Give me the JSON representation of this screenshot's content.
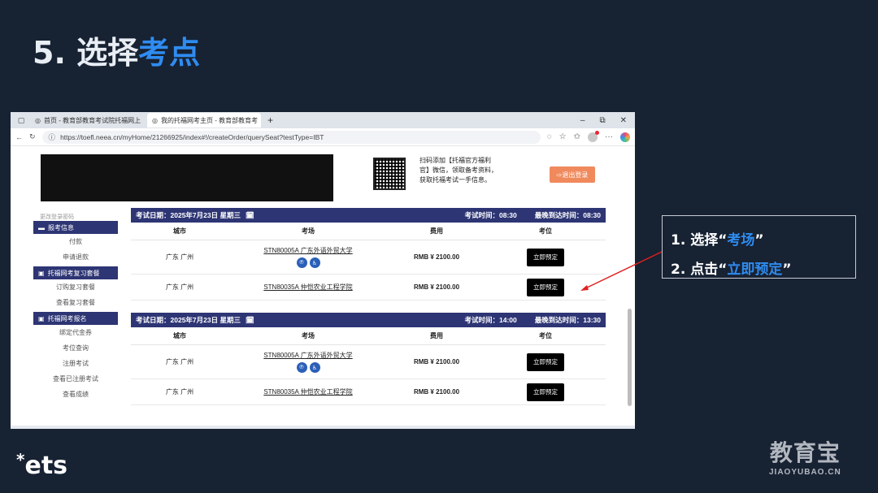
{
  "slide": {
    "title_prefix": "5. 选择",
    "title_accent": "考点"
  },
  "browser": {
    "tabs": [
      {
        "label": "首页 - 教育部教育考试院托福网上",
        "active": false
      },
      {
        "label": "我的托福网考主页 - 教育部教育考",
        "active": true
      }
    ],
    "window_controls": [
      "–",
      "⧉",
      "✕"
    ],
    "url": "https://toefl.neea.cn/myHome/21266925/index#!/createOrder/querySeat?testType=IBT"
  },
  "page": {
    "promo_text": "扫码添加【托福官方福利官】微信，领取备考资料，获取托福考试一手信息。",
    "logout_label": "退出登录",
    "sidebar": {
      "faded_top": "更改登录密码",
      "sections": [
        {
          "title": "报考信息",
          "items": [
            "付款",
            "申请退款"
          ]
        },
        {
          "title": "托福网考复习套餐",
          "items": [
            "订购复习套餐",
            "查看复习套餐"
          ]
        },
        {
          "title": "托福网考报名",
          "items": [
            "绑定代金券",
            "考位查询",
            "注册考试",
            "查看已注册考试",
            "查看成绩"
          ]
        }
      ]
    },
    "columns": [
      "城市",
      "考场",
      "费用",
      "考位"
    ],
    "exams": [
      {
        "date_label": "考试日期：",
        "date": "2025年7月23日 星期三",
        "time_label": "考试时间：",
        "time": "08:30",
        "arrive_label": "最晚到达时间：",
        "arrive": "08:30",
        "rows": [
          {
            "city": "广东 广州",
            "center_code": "STN80005A",
            "center_name": "广东外语外贸大学",
            "badges": true,
            "fee": "RMB ¥ 2100.00",
            "action": "立即预定"
          },
          {
            "city": "广东 广州",
            "center_code": "STN80035A",
            "center_name": "仲恺农业工程学院",
            "badges": false,
            "fee": "RMB ¥ 2100.00",
            "action": "立即预定"
          }
        ]
      },
      {
        "date_label": "考试日期：",
        "date": "2025年7月23日 星期三",
        "time_label": "考试时间：",
        "time": "14:00",
        "arrive_label": "最晚到达时间：",
        "arrive": "13:30",
        "rows": [
          {
            "city": "广东 广州",
            "center_code": "STN80005A",
            "center_name": "广东外语外贸大学",
            "badges": true,
            "fee": "RMB ¥ 2100.00",
            "action": "立即预定"
          },
          {
            "city": "广东 广州",
            "center_code": "STN80035A",
            "center_name": "仲恺农业工程学院",
            "badges": false,
            "fee": "RMB ¥ 2100.00",
            "action": "立即预定"
          }
        ]
      }
    ]
  },
  "annotation": {
    "line1_prefix": "1. 选择“",
    "line1_highlight": "考场",
    "line1_suffix": "”",
    "line2_prefix": "2. 点击“",
    "line2_highlight": "立即预定",
    "line2_suffix": "”"
  },
  "logos": {
    "ets": "ets",
    "jyb_cn": "教育宝",
    "jyb_en": "JIAOYUBAO.CN"
  },
  "colors": {
    "background": "#172233",
    "accent": "#2f8cf0",
    "header_navy": "#2d3574",
    "button_black": "#000000",
    "logout_orange": "#f08a5d",
    "arrow_red": "#e02020"
  }
}
